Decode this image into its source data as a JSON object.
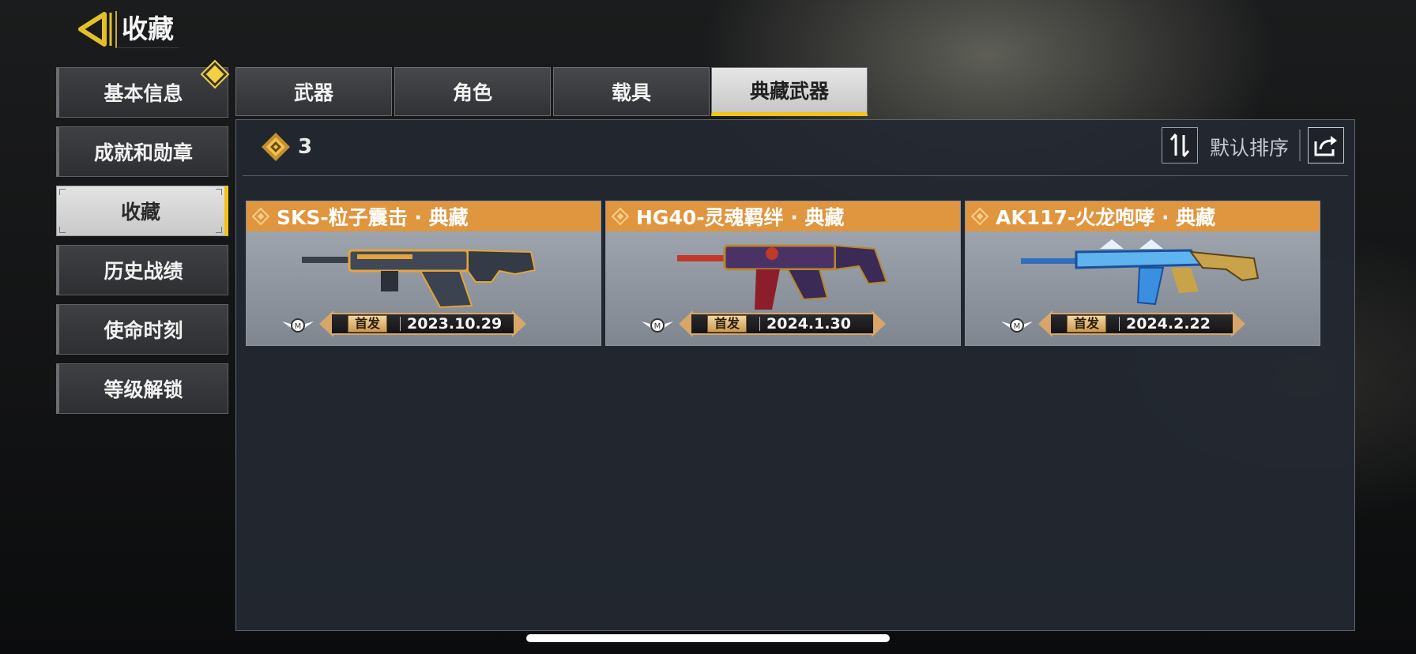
{
  "header": {
    "title": "收藏"
  },
  "sidebar": {
    "items": [
      {
        "label": "基本信息"
      },
      {
        "label": "成就和勋章"
      },
      {
        "label": "收藏"
      },
      {
        "label": "历史战绩"
      },
      {
        "label": "使命时刻"
      },
      {
        "label": "等级解锁"
      }
    ],
    "active_index": 2
  },
  "tabs": [
    {
      "label": "武器"
    },
    {
      "label": "角色"
    },
    {
      "label": "载具"
    },
    {
      "label": "典藏武器"
    }
  ],
  "active_tab_index": 3,
  "panel": {
    "count": "3",
    "sort_label": "默认排序"
  },
  "cards": [
    {
      "name": "SKS-粒子震击 · 典藏",
      "badge": "首发",
      "date": "2023.10.29",
      "gun_icon": "rifle-icon"
    },
    {
      "name": "HG40-灵魂羁绊 · 典藏",
      "badge": "首发",
      "date": "2024.1.30",
      "gun_icon": "smg-icon"
    },
    {
      "name": "AK117-火龙咆哮 · 典藏",
      "badge": "首发",
      "date": "2024.2.22",
      "gun_icon": "assault-rifle-icon"
    }
  ],
  "colors": {
    "accent_yellow": "#f2c318",
    "card_header_orange": "#e0953f"
  }
}
